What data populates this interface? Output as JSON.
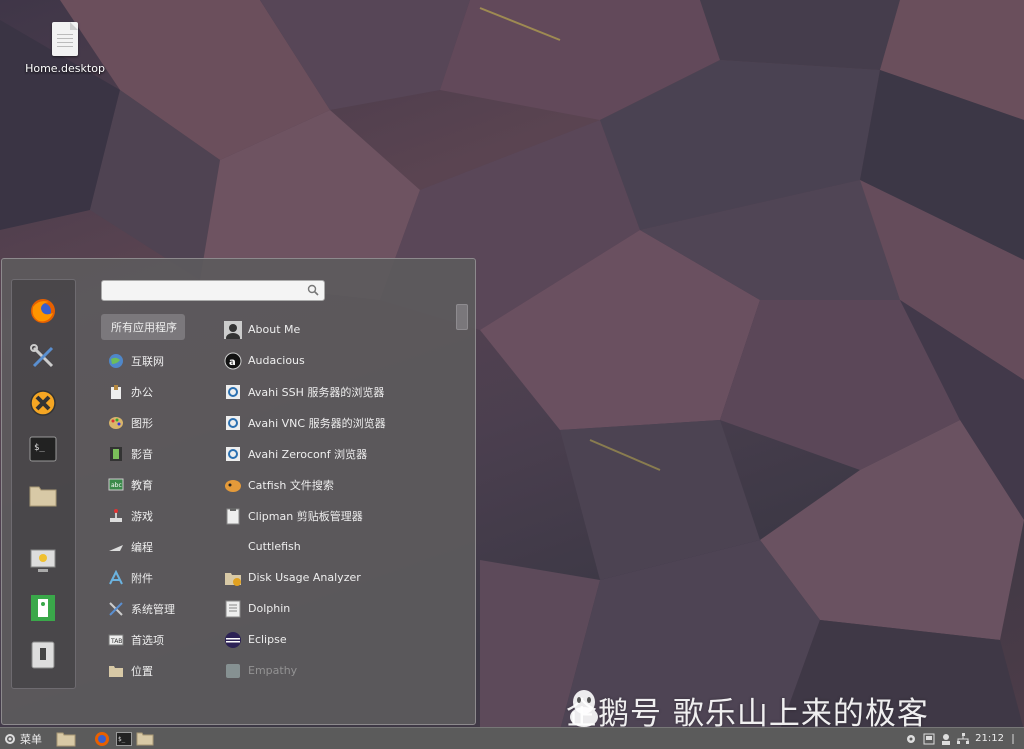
{
  "desktop": {
    "icons": [
      {
        "label": "Home.desktop",
        "icon": "text-file-icon"
      }
    ],
    "watermark": "企鹅号 歌乐山上来的极客"
  },
  "menu": {
    "search": {
      "value": "",
      "placeholder": ""
    },
    "favorites": [
      {
        "name": "firefox-icon"
      },
      {
        "name": "settings-tools-icon"
      },
      {
        "name": "xfce-cross-icon"
      },
      {
        "name": "terminal-icon"
      },
      {
        "name": "folder-icon"
      },
      {
        "name": "lock-screen-icon"
      },
      {
        "name": "logout-icon"
      },
      {
        "name": "shutdown-icon"
      }
    ],
    "categories": [
      {
        "label": "所有应用程序",
        "icon": ""
      },
      {
        "label": "互联网",
        "icon": "globe-icon"
      },
      {
        "label": "办公",
        "icon": "office-icon"
      },
      {
        "label": "图形",
        "icon": "graphics-palette-icon"
      },
      {
        "label": "影音",
        "icon": "multimedia-film-icon"
      },
      {
        "label": "教育",
        "icon": "education-icon"
      },
      {
        "label": "游戏",
        "icon": "games-joystick-icon"
      },
      {
        "label": "编程",
        "icon": "programming-icon"
      },
      {
        "label": "附件",
        "icon": "accessories-icon"
      },
      {
        "label": "系统管理",
        "icon": "system-tools-icon"
      },
      {
        "label": "首选项",
        "icon": "preferences-icon"
      },
      {
        "label": "位置",
        "icon": "places-folder-icon"
      }
    ],
    "apps": [
      {
        "label": "About Me",
        "icon": "user-avatar-icon"
      },
      {
        "label": "Audacious",
        "icon": "audacious-icon"
      },
      {
        "label": "Avahi SSH 服务器的浏览器",
        "icon": "avahi-ssh-icon"
      },
      {
        "label": "Avahi VNC 服务器的浏览器",
        "icon": "avahi-vnc-icon"
      },
      {
        "label": "Avahi Zeroconf 浏览器",
        "icon": "avahi-zeroconf-icon"
      },
      {
        "label": "Catfish 文件搜索",
        "icon": "catfish-icon"
      },
      {
        "label": "Clipman 剪贴板管理器",
        "icon": "clipboard-icon"
      },
      {
        "label": "Cuttlefish",
        "icon": ""
      },
      {
        "label": "Disk Usage Analyzer",
        "icon": "disk-usage-icon"
      },
      {
        "label": "Dolphin",
        "icon": "dolphin-icon"
      },
      {
        "label": "Eclipse",
        "icon": "eclipse-icon"
      },
      {
        "label": "Empathy",
        "icon": "empathy-icon"
      }
    ]
  },
  "panel": {
    "menu_label": "菜单",
    "clock": "21:12"
  }
}
